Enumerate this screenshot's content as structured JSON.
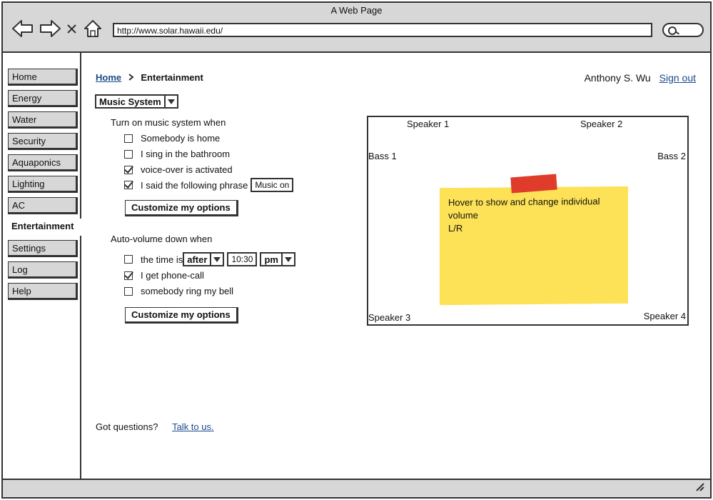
{
  "window": {
    "title": "A Web Page",
    "url": "http://www.solar.hawaii.edu/"
  },
  "icons": {
    "back": "back-arrow-icon",
    "forward": "forward-arrow-icon",
    "stop": "close-icon",
    "home": "home-icon",
    "search": "search-icon",
    "resize": "resize-grip-icon"
  },
  "sidebar": {
    "items": [
      {
        "label": "Home"
      },
      {
        "label": "Energy"
      },
      {
        "label": "Water"
      },
      {
        "label": "Security"
      },
      {
        "label": "Aquaponics"
      },
      {
        "label": "Lighting"
      },
      {
        "label": "AC"
      },
      {
        "label": "Entertainment",
        "active": true
      },
      {
        "label": "Settings"
      },
      {
        "label": "Log"
      },
      {
        "label": "Help"
      }
    ]
  },
  "breadcrumb": {
    "home": "Home",
    "current": "Entertainment"
  },
  "user": {
    "name": "Anthony S. Wu",
    "signout": "Sign out"
  },
  "music_select": {
    "value": "Music System"
  },
  "turn_on": {
    "heading": "Turn on music system when",
    "options": [
      {
        "label": "Somebody is home",
        "checked": false
      },
      {
        "label": "I sing in the bathroom",
        "checked": false
      },
      {
        "label": "voice-over is activated",
        "checked": true
      },
      {
        "label": "I said the following phrase",
        "checked": true,
        "phrase": "Music on"
      }
    ],
    "button": "Customize my options"
  },
  "auto_volume": {
    "heading": "Auto-volume down when",
    "time_label": "the time is",
    "time_mode": "after",
    "time_value": "10:30",
    "time_period": "pm",
    "time_checked": false,
    "options": [
      {
        "label": "I get phone-call",
        "checked": true
      },
      {
        "label": "somebody ring my bell",
        "checked": false
      }
    ],
    "button": "Customize my options"
  },
  "speakers": {
    "speaker1": "Speaker 1",
    "speaker2": "Speaker 2",
    "bass1": "Bass 1",
    "bass2": "Bass 2",
    "speaker3": "Speaker 3",
    "speaker4": "Speaker 4",
    "note": "Hover to show and change individual volume",
    "note_line2": "L/R"
  },
  "footer": {
    "question": "Got questions?",
    "link": "Talk to us."
  },
  "colors": {
    "chrome": "#d7d7d7",
    "link": "#1a4a8a",
    "note": "#fde257",
    "tape": "#e03c2c"
  }
}
